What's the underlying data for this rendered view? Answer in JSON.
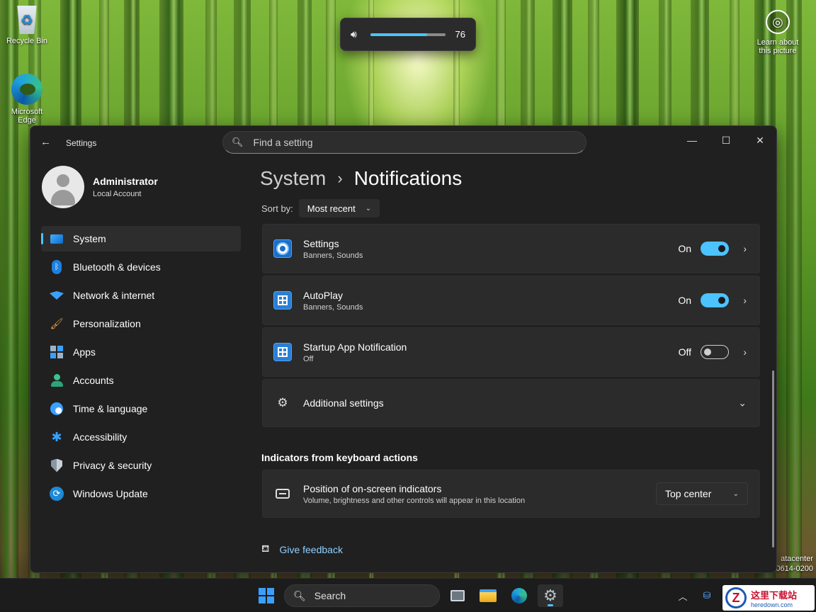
{
  "desktop": {
    "recycle_bin": "Recycle Bin",
    "edge": "Microsoft Edge",
    "learn_line1": "Learn about",
    "learn_line2": "this picture",
    "corner_text_line1": "atacenter",
    "corner_text_line2": "0614-0200"
  },
  "volume": {
    "level": 76,
    "level_fraction": 0.76,
    "icon": "speaker-icon"
  },
  "window": {
    "app_title": "Settings",
    "search_placeholder": "Find a setting",
    "controls": {
      "minimize": "—",
      "maximize": "☐",
      "close": "✕"
    }
  },
  "profile": {
    "name": "Administrator",
    "account_type": "Local Account"
  },
  "sidebar": {
    "items": [
      {
        "label": "System",
        "icon": "monitor-icon",
        "active": true
      },
      {
        "label": "Bluetooth & devices",
        "icon": "bluetooth-icon"
      },
      {
        "label": "Network & internet",
        "icon": "wifi-icon"
      },
      {
        "label": "Personalization",
        "icon": "brush-icon"
      },
      {
        "label": "Apps",
        "icon": "apps-icon"
      },
      {
        "label": "Accounts",
        "icon": "person-icon"
      },
      {
        "label": "Time & language",
        "icon": "globe-clock-icon"
      },
      {
        "label": "Accessibility",
        "icon": "accessibility-icon"
      },
      {
        "label": "Privacy & security",
        "icon": "shield-icon"
      },
      {
        "label": "Windows Update",
        "icon": "update-icon"
      }
    ]
  },
  "breadcrumb": {
    "parent": "System",
    "separator": "›",
    "current": "Notifications"
  },
  "sort": {
    "label": "Sort by:",
    "value": "Most recent"
  },
  "notifications": [
    {
      "title": "Settings",
      "subtitle": "Banners, Sounds",
      "state": "On",
      "on": true,
      "icon": "settings-app-icon"
    },
    {
      "title": "AutoPlay",
      "subtitle": "Banners, Sounds",
      "state": "On",
      "on": true,
      "icon": "autoplay-app-icon"
    },
    {
      "title": "Startup App Notification",
      "subtitle": "Off",
      "state": "Off",
      "on": false,
      "icon": "startup-app-icon"
    }
  ],
  "additional": {
    "label": "Additional settings",
    "icon": "gears-icon"
  },
  "indicators": {
    "section_title": "Indicators from keyboard actions",
    "title": "Position of on-screen indicators",
    "description": "Volume, brightness and other controls will appear in this location",
    "value": "Top center",
    "icon": "keyboard-indicator-icon"
  },
  "feedback": {
    "label": "Give feedback",
    "icon": "feedback-icon"
  },
  "taskbar": {
    "search_label": "Search",
    "items": [
      "start-icon",
      "search",
      "task-view-icon",
      "file-explorer-icon",
      "edge-icon",
      "settings-icon"
    ]
  },
  "watermark": {
    "line1": "这里下载站",
    "line2": "heredown.com",
    "logo_letter": "Z"
  },
  "colors": {
    "accent": "#4cc2ff",
    "window_bg": "#202020",
    "card_bg": "#2b2b2b"
  }
}
